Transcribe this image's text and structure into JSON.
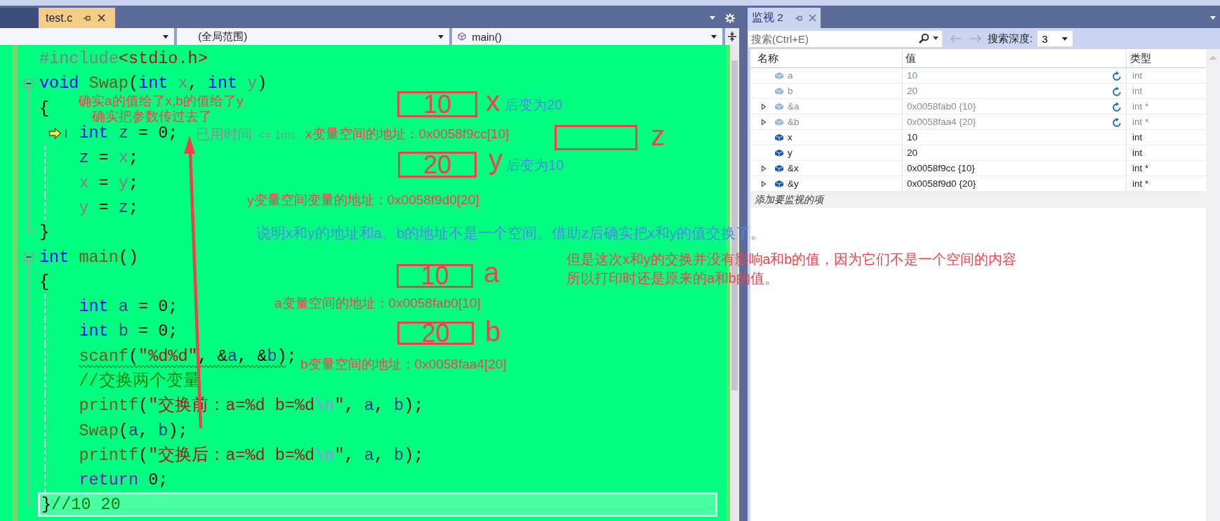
{
  "editor": {
    "tabs": [
      {
        "label": "test.c",
        "selected": true
      }
    ],
    "nav_dropdowns": [
      {
        "kind": "blank"
      },
      {
        "kind": "scope",
        "text": "(全局范围)"
      },
      {
        "kind": "member",
        "text": "main()"
      }
    ],
    "lines": [
      {
        "kind": "plain",
        "body": false,
        "current": false,
        "highlighted": false,
        "tokens": [
          {
            "text": "#include",
            "kind": "pre"
          },
          {
            "text": "<stdio.h>",
            "kind": "header"
          }
        ]
      },
      {
        "kind": "open",
        "body": false,
        "current": false,
        "highlighted": false,
        "tokens": [
          {
            "text": "void",
            "kind": "kw"
          },
          {
            "text": " Swap",
            "kind": "fn"
          },
          {
            "text": "(",
            "kind": "punct"
          },
          {
            "text": "int",
            "kind": "kw"
          },
          {
            "text": " x",
            "kind": "param"
          },
          {
            "text": ", ",
            "kind": "punct"
          },
          {
            "text": "int",
            "kind": "kw"
          },
          {
            "text": " y",
            "kind": "param"
          },
          {
            "text": ")",
            "kind": "punct"
          }
        ]
      },
      {
        "kind": "inner",
        "body": false,
        "current": false,
        "highlighted": false,
        "tokens": [
          {
            "text": "{",
            "kind": "punct"
          }
        ]
      },
      {
        "kind": "inner",
        "body": true,
        "current": true,
        "highlighted": false,
        "tokens": [
          {
            "text": "int",
            "kind": "kw"
          },
          {
            "text": " z",
            "kind": "local"
          },
          {
            "text": " = ",
            "kind": "punct"
          },
          {
            "text": "0",
            "kind": "num"
          },
          {
            "text": ";",
            "kind": "punct"
          }
        ]
      },
      {
        "kind": "inner",
        "body": true,
        "current": false,
        "highlighted": false,
        "tokens": [
          {
            "text": "z",
            "kind": "local"
          },
          {
            "text": " = ",
            "kind": "punct"
          },
          {
            "text": "x",
            "kind": "param"
          },
          {
            "text": ";",
            "kind": "punct"
          }
        ]
      },
      {
        "kind": "inner",
        "body": true,
        "current": false,
        "highlighted": false,
        "tokens": [
          {
            "text": "x",
            "kind": "param"
          },
          {
            "text": " = ",
            "kind": "punct"
          },
          {
            "text": "y",
            "kind": "param"
          },
          {
            "text": ";",
            "kind": "punct"
          }
        ]
      },
      {
        "kind": "inner",
        "body": true,
        "current": false,
        "highlighted": false,
        "tokens": [
          {
            "text": "y",
            "kind": "param"
          },
          {
            "text": " = ",
            "kind": "punct"
          },
          {
            "text": "z",
            "kind": "local"
          },
          {
            "text": ";",
            "kind": "punct"
          }
        ]
      },
      {
        "kind": "close",
        "body": false,
        "current": false,
        "highlighted": false,
        "tokens": [
          {
            "text": "}",
            "kind": "punct"
          }
        ]
      },
      {
        "kind": "open",
        "body": false,
        "current": false,
        "highlighted": false,
        "tokens": [
          {
            "text": "int",
            "kind": "kw"
          },
          {
            "text": " main",
            "kind": "fn"
          },
          {
            "text": "()",
            "kind": "punct"
          }
        ]
      },
      {
        "kind": "inner",
        "body": false,
        "current": false,
        "highlighted": false,
        "tokens": [
          {
            "text": "{",
            "kind": "punct"
          }
        ]
      },
      {
        "kind": "inner",
        "body": true,
        "current": false,
        "highlighted": false,
        "tokens": [
          {
            "text": "int",
            "kind": "kw"
          },
          {
            "text": " a",
            "kind": "local"
          },
          {
            "text": " = ",
            "kind": "punct"
          },
          {
            "text": "0",
            "kind": "num"
          },
          {
            "text": ";",
            "kind": "punct"
          }
        ]
      },
      {
        "kind": "inner",
        "body": true,
        "current": false,
        "highlighted": false,
        "tokens": [
          {
            "text": "int",
            "kind": "kw"
          },
          {
            "text": " b",
            "kind": "local"
          },
          {
            "text": " = ",
            "kind": "punct"
          },
          {
            "text": "0",
            "kind": "num"
          },
          {
            "text": ";",
            "kind": "punct"
          }
        ]
      },
      {
        "kind": "inner",
        "body": true,
        "current": false,
        "highlighted": false,
        "tokens": [
          {
            "text": "scanf",
            "kind": "fn"
          },
          {
            "text": "(",
            "kind": "punct"
          },
          {
            "text": "\"%d%d\"",
            "kind": "str"
          },
          {
            "text": ", &",
            "kind": "punct"
          },
          {
            "text": "a",
            "kind": "local"
          },
          {
            "text": ", &",
            "kind": "punct"
          },
          {
            "text": "b",
            "kind": "local"
          },
          {
            "text": ")",
            "kind": "punct"
          },
          {
            "text": ";",
            "kind": "punct"
          }
        ],
        "squiggle": true
      },
      {
        "kind": "inner",
        "body": true,
        "current": false,
        "highlighted": false,
        "tokens": [
          {
            "text": "//交换两个变量",
            "kind": "comment"
          }
        ]
      },
      {
        "kind": "inner",
        "body": true,
        "current": false,
        "highlighted": false,
        "tokens": [
          {
            "text": "printf",
            "kind": "fn"
          },
          {
            "text": "(",
            "kind": "punct"
          },
          {
            "text": "\"交换前：a=%d b=%d",
            "kind": "str"
          },
          {
            "text": "\\n",
            "kind": "esc"
          },
          {
            "text": "\"",
            "kind": "str"
          },
          {
            "text": ", ",
            "kind": "punct"
          },
          {
            "text": "a",
            "kind": "local"
          },
          {
            "text": ", ",
            "kind": "punct"
          },
          {
            "text": "b",
            "kind": "local"
          },
          {
            "text": ");",
            "kind": "punct"
          }
        ]
      },
      {
        "kind": "inner",
        "body": true,
        "current": false,
        "highlighted": false,
        "tokens": [
          {
            "text": "Swap",
            "kind": "fn"
          },
          {
            "text": "(",
            "kind": "punct"
          },
          {
            "text": "a",
            "kind": "local"
          },
          {
            "text": ", ",
            "kind": "punct"
          },
          {
            "text": "b",
            "kind": "local"
          },
          {
            "text": ");",
            "kind": "punct"
          }
        ]
      },
      {
        "kind": "inner",
        "body": true,
        "current": false,
        "highlighted": false,
        "tokens": [
          {
            "text": "printf",
            "kind": "fn"
          },
          {
            "text": "(",
            "kind": "punct"
          },
          {
            "text": "\"交换后：a=%d b=%d",
            "kind": "str"
          },
          {
            "text": "\\n",
            "kind": "esc"
          },
          {
            "text": "\"",
            "kind": "str"
          },
          {
            "text": ", ",
            "kind": "punct"
          },
          {
            "text": "a",
            "kind": "local"
          },
          {
            "text": ", ",
            "kind": "punct"
          },
          {
            "text": "b",
            "kind": "local"
          },
          {
            "text": ");",
            "kind": "punct"
          }
        ]
      },
      {
        "kind": "inner",
        "body": true,
        "current": false,
        "highlighted": false,
        "tokens": [
          {
            "text": "return",
            "kind": "ctrl"
          },
          {
            "text": " 0",
            "kind": "num"
          },
          {
            "text": ";",
            "kind": "punct"
          }
        ]
      },
      {
        "kind": "close",
        "body": false,
        "current": false,
        "highlighted": true,
        "tokens": [
          {
            "text": "}",
            "kind": "punct"
          },
          {
            "text": "//10 20",
            "kind": "comment"
          }
        ]
      }
    ]
  },
  "watch": {
    "tab": {
      "title": "监视 2",
      "selected": true
    },
    "search": {
      "placeholder": "搜索(Ctrl+E)"
    },
    "depth_label": "搜索深度:",
    "depth": "3",
    "columns": [
      "名称",
      "值",
      "类型"
    ],
    "rows": [
      {
        "name": "a",
        "value": "10",
        "type": "int",
        "stale": true,
        "expandable": false
      },
      {
        "name": "b",
        "value": "20",
        "type": "int",
        "stale": true,
        "expandable": false
      },
      {
        "name": "&a",
        "value": "0x0058fab0 {10}",
        "type": "int *",
        "stale": true,
        "expandable": true
      },
      {
        "name": "&b",
        "value": "0x0058faa4 {20}",
        "type": "int *",
        "stale": true,
        "expandable": true
      },
      {
        "name": "x",
        "value": "10",
        "type": "int",
        "stale": false,
        "expandable": false
      },
      {
        "name": "y",
        "value": "20",
        "type": "int",
        "stale": false,
        "expandable": false
      },
      {
        "name": "&x",
        "value": "0x0058f9cc {10}",
        "type": "int *",
        "stale": false,
        "expandable": true
      },
      {
        "name": "&y",
        "value": "0x0058f9d0 {20}",
        "type": "int *",
        "stale": false,
        "expandable": true
      }
    ],
    "add_row": "添加要监视的项"
  },
  "annotations": [
    {
      "kind": "note",
      "text": "确实a的值给了x,b的值给了y",
      "color": "#f2404a"
    },
    {
      "kind": "note",
      "text": "确实把参数传过去了",
      "color": "#f2404a"
    },
    {
      "kind": "box",
      "text": "10",
      "color": "#f2404a"
    },
    {
      "kind": "label",
      "text": "x",
      "color": "#f2404a"
    },
    {
      "kind": "note",
      "text": "后变为20",
      "color": "#4f86e8"
    },
    {
      "kind": "perf-tip",
      "text": "已用时间",
      "detail": "<= 1ms",
      "color": "#8c8c8c"
    },
    {
      "kind": "note",
      "text": "x变量空间的地址：0x0058f9cc[10]",
      "color": "#f2404a"
    },
    {
      "kind": "box",
      "color": "#f2404a"
    },
    {
      "kind": "label",
      "text": "z",
      "color": "#f2404a"
    },
    {
      "kind": "box",
      "text": "20",
      "color": "#f2404a"
    },
    {
      "kind": "label",
      "text": "y",
      "color": "#f2404a"
    },
    {
      "kind": "note",
      "text": "后变为10",
      "color": "#4f86e8"
    },
    {
      "kind": "note",
      "text": "y变量空间变量的地址：0x0058f9d0[20]",
      "color": "#f2404a"
    },
    {
      "kind": "note",
      "text": "说明x和y的地址和a、b的地址不是一个空间。借助z后确实把x和y的值交换了。",
      "color": "#4f86e8"
    },
    {
      "kind": "note",
      "text": "但是这次x和y的交换并没有影响a和b的值，因为它们不是一个空间的内容",
      "color": "#f2404a"
    },
    {
      "kind": "box",
      "text": "10",
      "color": "#f2404a"
    },
    {
      "kind": "label",
      "text": "a",
      "color": "#f2404a"
    },
    {
      "kind": "note",
      "text": "所以打印时还是原来的a和b的值。",
      "color": "#f2404a"
    },
    {
      "kind": "note",
      "text": "a变量空间的地址：0x0058fab0[10]",
      "color": "#f2404a"
    },
    {
      "kind": "box",
      "text": "20",
      "color": "#f2404a"
    },
    {
      "kind": "label",
      "text": "b",
      "color": "#f2404a"
    },
    {
      "kind": "note",
      "text": "b变量空间的地址：0x0058faa4[20]",
      "color": "#f2404a"
    },
    {
      "kind": "arrow",
      "color": "#f2404a"
    }
  ]
}
